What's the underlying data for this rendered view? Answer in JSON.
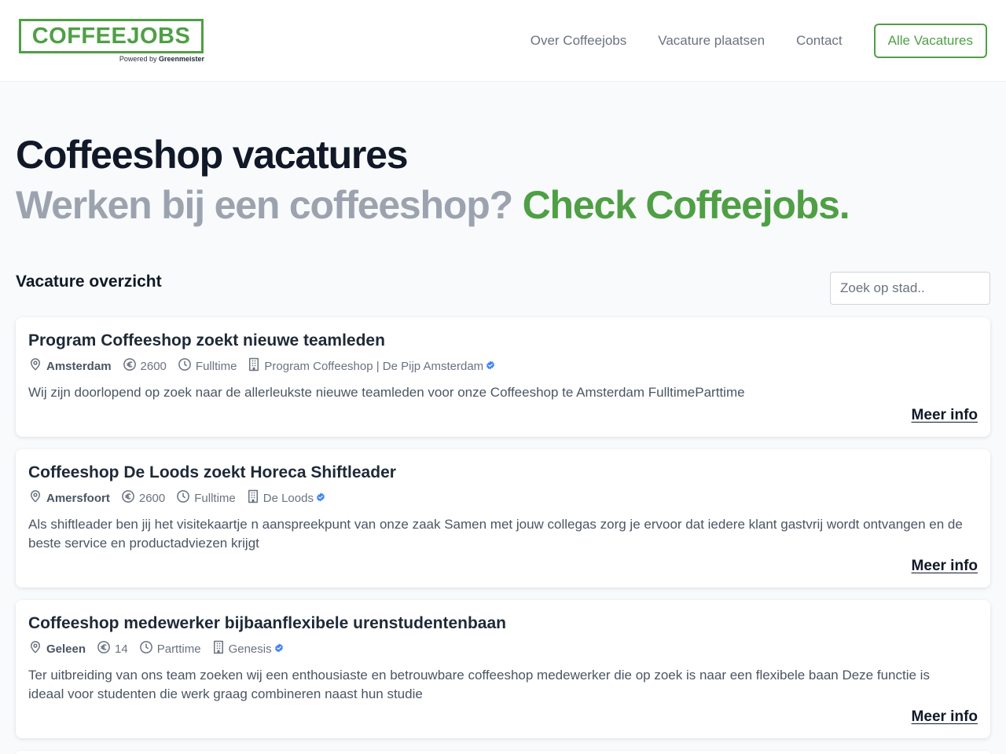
{
  "header": {
    "logo_text": "COFFEEJOBS",
    "logo_powered": "Powered by",
    "logo_brand": "Greenmeister",
    "nav": [
      {
        "label": "Over Coffeejobs"
      },
      {
        "label": "Vacature plaatsen"
      },
      {
        "label": "Contact"
      }
    ],
    "cta_label": "Alle Vacatures"
  },
  "hero": {
    "title": "Coffeeshop vacatures",
    "subtitle_muted": "Werken bij een coffeeshop? ",
    "subtitle_accent": "Check Coffeejobs."
  },
  "listing": {
    "title": "Vacature overzicht",
    "search_placeholder": "Zoek op stad.."
  },
  "jobs": [
    {
      "title": "Program Coffeeshop zoekt nieuwe teamleden",
      "city": "Amsterdam",
      "salary": "2600",
      "hours": "Fulltime",
      "company": "Program Coffeeshop | De Pijp Amsterdam",
      "description": "Wij zijn doorlopend op zoek naar de allerleukste nieuwe teamleden voor onze Coffeeshop te Amsterdam FulltimeParttime",
      "more_label": "Meer info"
    },
    {
      "title": "Coffeeshop De Loods zoekt Horeca Shiftleader",
      "city": "Amersfoort",
      "salary": "2600",
      "hours": "Fulltime",
      "company": "De Loods",
      "description": "Als shiftleader ben jij het visitekaartje n aanspreekpunt van onze zaak Samen met jouw collegas zorg je ervoor dat iedere klant gastvrij wordt ontvangen en de beste service en productadviezen krijgt",
      "more_label": "Meer info"
    },
    {
      "title": "Coffeeshop medewerker bijbaanflexibele urenstudentenbaan",
      "city": "Geleen",
      "salary": "14",
      "hours": "Parttime",
      "company": "Genesis",
      "description": "Ter uitbreiding van ons team zoeken wij een enthousiaste en betrouwbare coffeeshop medewerker die op zoek is naar een flexibele baan Deze functie is ideaal voor studenten die werk graag combineren naast hun studie",
      "more_label": "Meer info"
    }
  ],
  "icons": {
    "location": "map-pin-icon",
    "salary": "euro-icon",
    "hours": "clock-icon",
    "company": "building-icon",
    "verified": "verified-badge-icon"
  },
  "colors": {
    "brand_green": "#4f9f45",
    "verified_blue": "#3b82f6",
    "background": "#f8fafc"
  }
}
